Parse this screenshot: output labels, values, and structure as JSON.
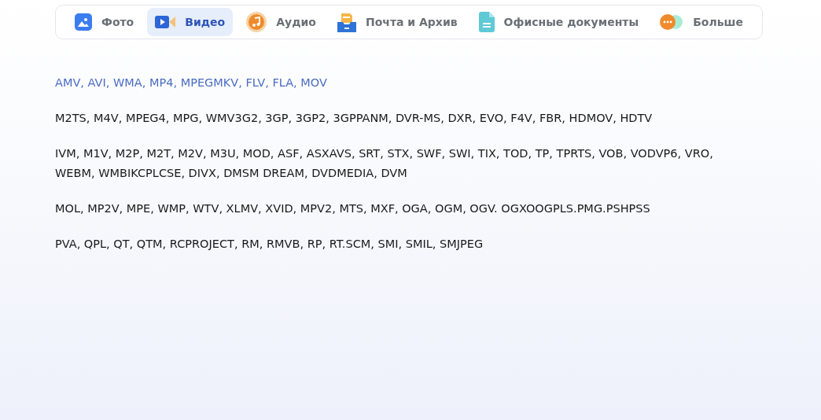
{
  "tabs": [
    {
      "label": "Фото",
      "selected": false
    },
    {
      "label": "Видео",
      "selected": true
    },
    {
      "label": "Аудио",
      "selected": false
    },
    {
      "label": "Почта и Архив",
      "selected": false
    },
    {
      "label": "Офисные документы",
      "selected": false
    },
    {
      "label": "Больше",
      "selected": false
    }
  ],
  "formats": [
    {
      "kind": "highlight",
      "text": "AMV, AVI, WMA, MP4, MPEGMKV, FLV, FLA, MOV"
    },
    {
      "kind": "plain",
      "text": "M2TS, M4V, MPEG4, MPG, WMV3G2, 3GP, 3GP2, 3GPPANM, DVR-MS, DXR, EVO, F4V, FBR, HDMOV, HDTV"
    },
    {
      "kind": "plain",
      "text": "IVM, M1V, M2P, M2T, M2V, M3U, MOD, ASF, ASXAVS, SRT, STX, SWF, SWI, TIX, TOD, TP, TPRTS, VOB, VODVP6, VRO, WEBM, WMBIKCPLCSE, DIVX, DMSM DREAM, DVDMEDIA, DVM"
    },
    {
      "kind": "plain",
      "text": "MOL, MP2V, MPE, WMP, WTV, XLMV, XVID, MPV2, MTS, MXF, OGA, OGM, OGV. OGXOOGPLS.PMG.PSHPSS"
    },
    {
      "kind": "plain",
      "text": "PVA, QPL, QT, QTM, RCPROJECT, RM, RMVB, RP, RT.SCM, SMI, SMIL, SMJPEG"
    }
  ]
}
